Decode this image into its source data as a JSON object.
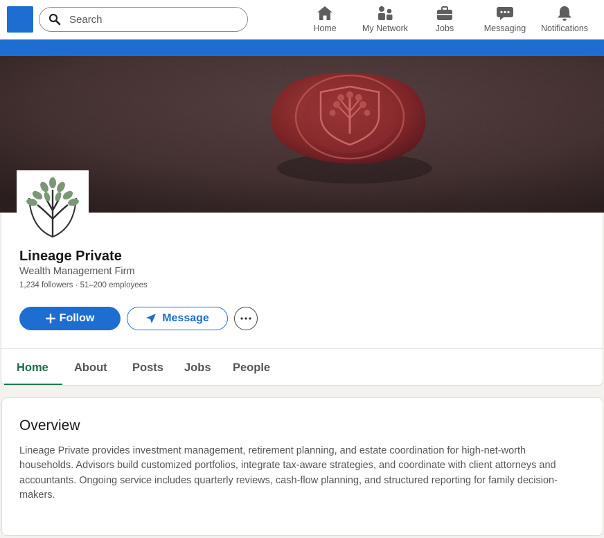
{
  "nav": {
    "search": {
      "placeholder": "Search",
      "value": ""
    },
    "items": [
      {
        "label": "Home",
        "icon": "home-icon"
      },
      {
        "label": "My Network",
        "icon": "people-icon"
      },
      {
        "label": "Jobs",
        "icon": "briefcase-icon"
      },
      {
        "label": "Messaging",
        "icon": "chat-bubble-icon"
      },
      {
        "label": "Notifications",
        "icon": "bell-icon"
      }
    ]
  },
  "colors": {
    "brand_blue": "#1d6ed0",
    "active_tab": "#1b6b46",
    "banner_leather": "#4f3b3b",
    "wax_seal": "#8b2e30"
  },
  "company": {
    "name": "Lineage Private",
    "industry": "Wealth Management Firm",
    "meta": "1,234 followers · 51–200 employees",
    "logo_icon": "tree-shield-logo",
    "banner_icon": "wax-seal-tree-crest"
  },
  "actions": {
    "follow_label": "Follow",
    "message_label": "Message",
    "more_icon": "ellipsis-icon"
  },
  "tabs": [
    {
      "label": "Home",
      "active": true
    },
    {
      "label": "About",
      "active": false
    },
    {
      "label": "Posts",
      "active": false
    },
    {
      "label": "Jobs",
      "active": false
    },
    {
      "label": "People",
      "active": false
    }
  ],
  "overview": {
    "title": "Overview",
    "text": "Lineage Private provides investment management, retirement planning, and estate coordination for high-net-worth households. Advisors build customized portfolios, integrate tax-aware strategies, and coordinate with client attorneys and accountants. Ongoing service includes quarterly reviews, cash-flow planning, and structured reporting for family decision-makers."
  }
}
